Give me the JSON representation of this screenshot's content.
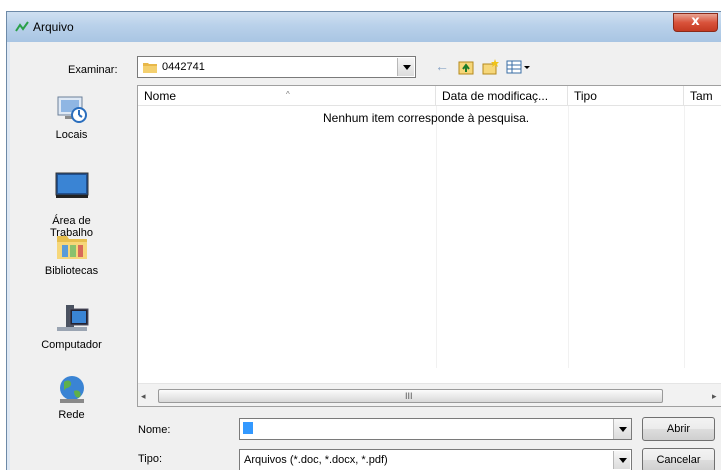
{
  "window": {
    "title": "Arquivo",
    "close_glyph": "x"
  },
  "lookin": {
    "label": "Examinar:",
    "folder": "0442741",
    "folder_icon": "folder-icon"
  },
  "toolbar": {
    "back_icon": "back-arrow-icon",
    "back_glyph": "←",
    "up_icon": "up-folder-icon",
    "new_folder_icon": "new-folder-icon",
    "view_icon": "view-menu-icon"
  },
  "places": [
    {
      "label": "Locais",
      "icon": "recent-places-icon"
    },
    {
      "label": "Área de\nTrabalho",
      "icon": "desktop-icon"
    },
    {
      "label": "Bibliotecas",
      "icon": "libraries-icon"
    },
    {
      "label": "Computador",
      "icon": "computer-icon"
    },
    {
      "label": "Rede",
      "icon": "network-icon"
    }
  ],
  "list": {
    "columns": [
      {
        "label": "Nome"
      },
      {
        "label": "Data de modificaç..."
      },
      {
        "label": "Tipo"
      },
      {
        "label": "Tam"
      }
    ],
    "empty_message": "Nenhum item corresponde à pesquisa.",
    "scroll_grip": "III",
    "scroll_left": "◂",
    "scroll_right": "▸"
  },
  "form": {
    "name_label": "Nome:",
    "name_value": "",
    "type_label": "Tipo:",
    "type_value": "Arquivos (*.doc, *.docx, *.pdf)"
  },
  "buttons": {
    "open": "Abrir",
    "cancel": "Cancelar"
  },
  "colors": {
    "titlebar": "#b9d1ea",
    "close": "#d9533b",
    "selection": "#3399ff"
  }
}
